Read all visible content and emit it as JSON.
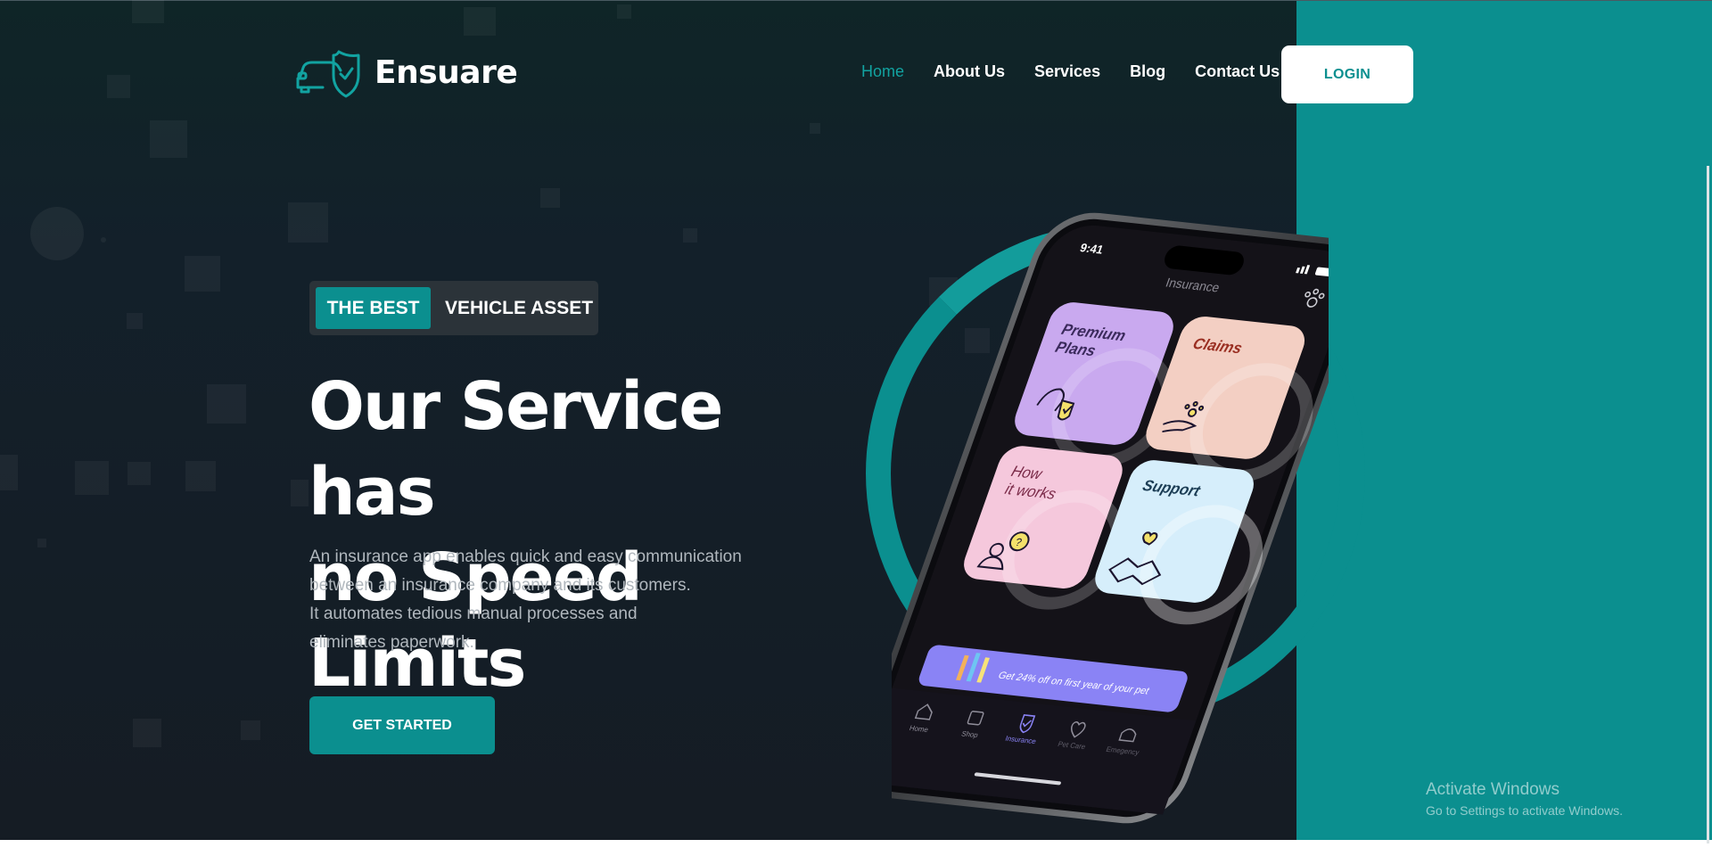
{
  "brand": {
    "name": "Ensuare",
    "logo_icon": "car-shield-icon"
  },
  "nav": {
    "items": [
      {
        "label": "Home",
        "active": true
      },
      {
        "label": "About Us",
        "active": false
      },
      {
        "label": "Services",
        "active": false
      },
      {
        "label": "Blog",
        "active": false
      },
      {
        "label": "Contact Us",
        "active": false
      }
    ],
    "login_label": "LOGIN"
  },
  "hero": {
    "tag_highlight": "THE BEST",
    "tag_text": "VEHICLE ASSET",
    "title_line1": "Our Service has",
    "title_line2": "no Speed Limits",
    "description": [
      "An insurance app enables quick and easy communication",
      "between an insurance company and its customers.",
      "It automates tedious manual processes and",
      "eliminates paperwork."
    ],
    "cta_label": "GET STARTED"
  },
  "phone": {
    "time": "9:41",
    "header": "Insurance",
    "cards": [
      {
        "label": "Premium Plans",
        "icon": "dog-shield-icon"
      },
      {
        "label": "Claims",
        "icon": "paw-hand-icon"
      },
      {
        "label": "How it works",
        "icon": "person-question-icon"
      },
      {
        "label": "Support",
        "icon": "handshake-heart-icon"
      }
    ],
    "banner": "Get 24% off on first year of your pet",
    "tabs": [
      {
        "label": "Home",
        "icon": "home-icon"
      },
      {
        "label": "Shop",
        "icon": "shop-icon"
      },
      {
        "label": "Insurance",
        "icon": "shield-check-icon",
        "active": true
      },
      {
        "label": "Pet Care",
        "icon": "heart-icon"
      },
      {
        "label": "Emegency",
        "icon": "siren-icon"
      }
    ]
  },
  "watermark": {
    "title": "Activate Windows",
    "subtitle": "Go to Settings to activate Windows."
  },
  "colors": {
    "accent": "#0b8f8f",
    "nav_active": "#12a3a1",
    "background_dark": "#151c24",
    "card_premium": "#c9a9ef",
    "card_claims": "#f3cfc3",
    "card_howitworks": "#f5c8dc",
    "card_support": "#d6eefb",
    "banner": "#8a83f5"
  }
}
